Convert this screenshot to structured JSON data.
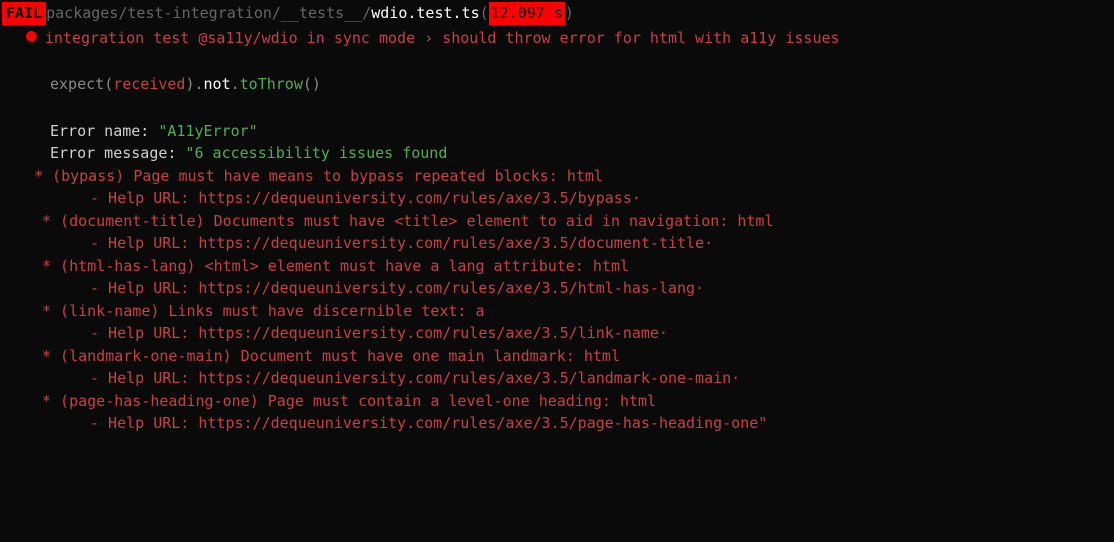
{
  "header": {
    "status": "FAIL",
    "path_prefix": " packages/test-integration/__tests__/",
    "filename": "wdio.test.ts",
    "open_paren": " (",
    "time": "12.097 s",
    "close_paren": ")"
  },
  "test": {
    "name": "integration test @sa11y/wdio in sync mode › should throw error for html with a11y issues"
  },
  "expect": {
    "expect": "expect",
    "open": "(",
    "received": "received",
    "close_dot": ").",
    "not": "not",
    "dot": ".",
    "method": "toThrow",
    "parens": "()"
  },
  "error": {
    "name_label": "Error name:    ",
    "name_value": "\"A11yError\"",
    "message_label": "Error message: ",
    "message_prefix": "\"6 accessibility issues found"
  },
  "issues": [
    {
      "rule": " * (bypass) Page must have means to bypass repeated blocks: html",
      "help": "- Help URL: https://dequeuniversity.com/rules/axe/3.5/bypass·",
      "first": true
    },
    {
      "rule": "* (document-title) Documents must have <title> element to aid in navigation: html",
      "help": "- Help URL: https://dequeuniversity.com/rules/axe/3.5/document-title·"
    },
    {
      "rule": "* (html-has-lang) <html> element must have a lang attribute: html",
      "help": "- Help URL: https://dequeuniversity.com/rules/axe/3.5/html-has-lang·"
    },
    {
      "rule": "* (link-name) Links must have discernible text: a",
      "help": "- Help URL: https://dequeuniversity.com/rules/axe/3.5/link-name·"
    },
    {
      "rule": "* (landmark-one-main) Document must have one main landmark: html",
      "help": "- Help URL: https://dequeuniversity.com/rules/axe/3.5/landmark-one-main·"
    },
    {
      "rule": "* (page-has-heading-one) Page must contain a level-one heading: html",
      "help": "- Help URL: https://dequeuniversity.com/rules/axe/3.5/page-has-heading-one\""
    }
  ]
}
